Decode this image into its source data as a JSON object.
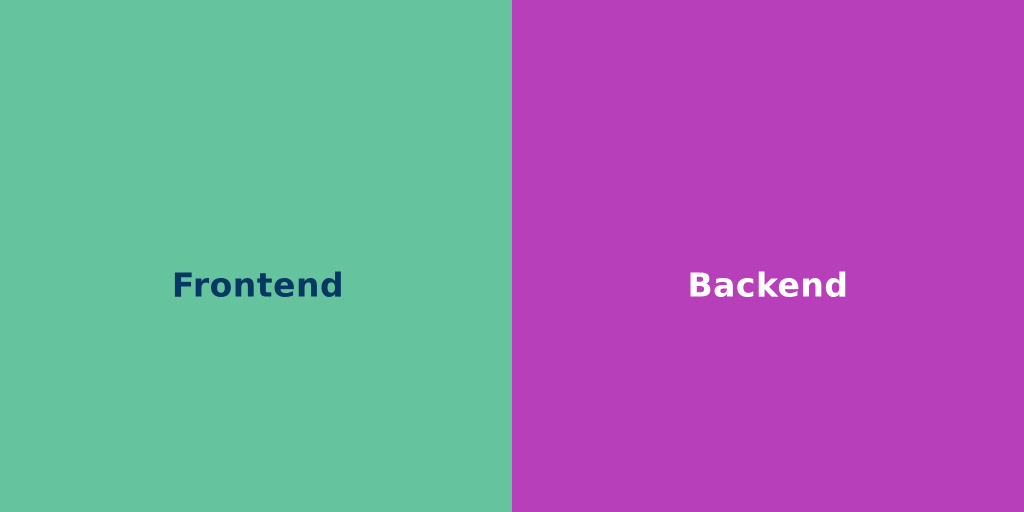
{
  "left": {
    "label": "Frontend",
    "background_color": "#65c39d",
    "text_color": "#073763"
  },
  "right": {
    "label": "Backend",
    "background_color": "#b73fba",
    "text_color": "#ffffff"
  }
}
